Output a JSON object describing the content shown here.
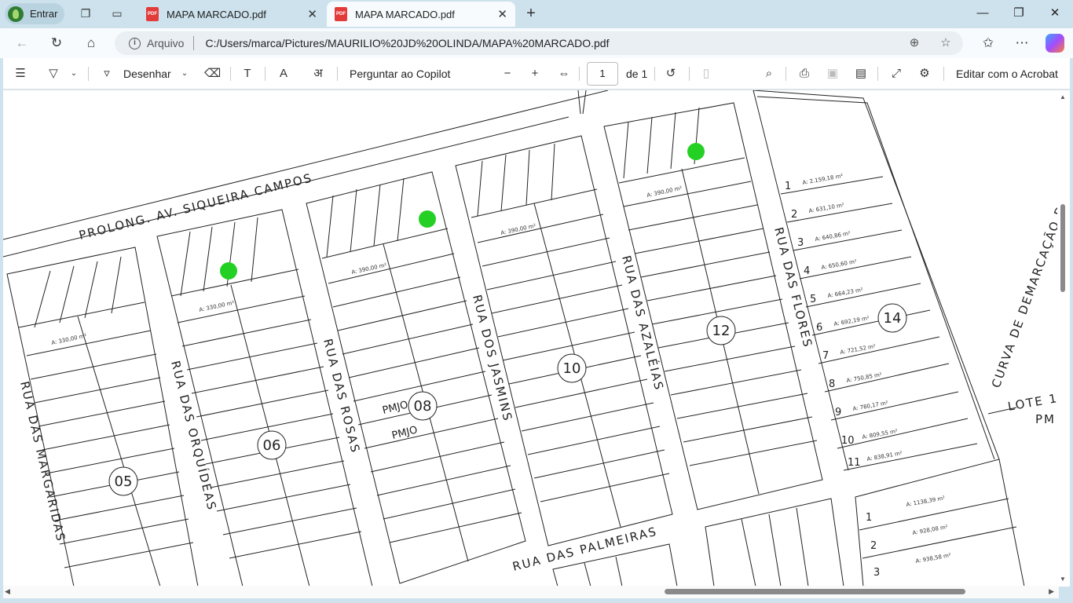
{
  "browser": {
    "profile_label": "Entrar",
    "tabs": [
      {
        "title": "MAPA MARCADO.pdf",
        "active": false
      },
      {
        "title": "MAPA MARCADO.pdf",
        "active": true
      }
    ],
    "new_tab_label": "+",
    "address_scheme_label": "Arquivo",
    "url": "C:/Users/marca/Pictures/MAURILIO%20JD%20OLINDA/MAPA%20MARCADO.pdf"
  },
  "pdf_toolbar": {
    "draw_label": "Desenhar",
    "copilot_label": "Perguntar ao Copilot",
    "page_current": "1",
    "page_total_label": "de 1",
    "acrobat_label": "Editar com o Acrobat"
  },
  "map": {
    "streets": [
      "PROLONG. AV. SIQUEIRA CAMPOS",
      "RUA DAS MARGARIDAS",
      "RUA DAS ORQUÍDEAS",
      "RUA DAS ROSAS",
      "RUA DOS JASMINS",
      "RUA DAS AZALÉIAS",
      "RUA DAS FLORES",
      "RUA DAS PALMEIRAS",
      "CURVA DE DEMARCAÇÃO DA CESP",
      "LOTE 1",
      "PM"
    ],
    "blocks": [
      "05",
      "06",
      "08",
      "10",
      "12",
      "14"
    ],
    "block14_lots": [
      {
        "n": "1",
        "area": "A: 2.159,18 m²"
      },
      {
        "n": "2",
        "area": "A: 631,10 m²"
      },
      {
        "n": "3",
        "area": "A: 640,86 m²"
      },
      {
        "n": "4",
        "area": "A: 650,60 m²"
      },
      {
        "n": "5",
        "area": "A: 664,23 m²"
      },
      {
        "n": "6",
        "area": "A: 692,19 m²"
      },
      {
        "n": "7",
        "area": "A: 721,52 m²"
      },
      {
        "n": "8",
        "area": "A: 750,85 m²"
      },
      {
        "n": "9",
        "area": "A: 780,17 m²"
      },
      {
        "n": "10",
        "area": "A: 809,55 m²"
      },
      {
        "n": "11",
        "area": "A: 838,91 m²"
      }
    ],
    "lower_lots": [
      {
        "n": "1",
        "area": "A: 1138,39 m²"
      },
      {
        "n": "2",
        "area": "A: 928,08 m²"
      },
      {
        "n": "3",
        "area": "A: 938,58 m²"
      }
    ],
    "pmjo_labels": [
      "PMJO",
      "PMJO"
    ],
    "lot_area_small": "A: 330,00 m²",
    "lot_area_large": "A: 390,00 m²",
    "marker_color": "#24d024"
  }
}
